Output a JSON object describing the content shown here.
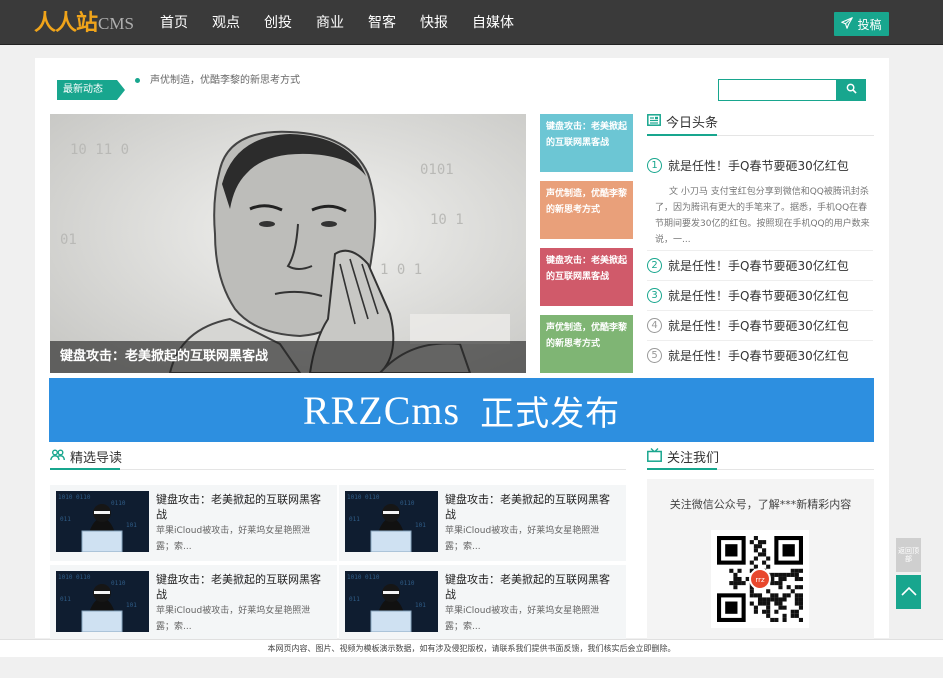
{
  "header": {
    "logo_cn": "人人站",
    "logo_en": "CMS",
    "nav": [
      "首页",
      "观点",
      "创投",
      "商业",
      "智客",
      "快报",
      "自媒体"
    ],
    "post_label": "投稿"
  },
  "news": {
    "tag": "最新动态",
    "ticker": "声优制造，优酷李黎的新思考方式"
  },
  "search": {
    "placeholder": ""
  },
  "hero": {
    "caption": "键盘攻击：老美掀起的互联网黑客战"
  },
  "tiles": [
    {
      "title": "键盘攻击：老美掀起的互联网黑客战",
      "color": "#6cc6d4"
    },
    {
      "title": "声优制造，优酷李黎的新思考方式",
      "color": "#e9a07a"
    },
    {
      "title": "键盘攻击：老美掀起的互联网黑客战",
      "color": "#d05a6a"
    },
    {
      "title": "声优制造，优酷李黎的新思考方式",
      "color": "#7fb574"
    }
  ],
  "headlines": {
    "title": "今日头条",
    "summary": "文 小刀马 支付宝红包分享到微信和QQ被腾讯封杀了，因为腾讯有更大的手笔来了。据悉，手机QQ在春节期间要发30亿的红包。按照现在手机QQ的用户数来说，一...",
    "items": [
      {
        "num": "1",
        "text": "就是任性！手Q春节要砸30亿红包"
      },
      {
        "num": "2",
        "text": "就是任性！手Q春节要砸30亿红包"
      },
      {
        "num": "3",
        "text": "就是任性！手Q春节要砸30亿红包"
      },
      {
        "num": "4",
        "text": "就是任性！手Q春节要砸30亿红包"
      },
      {
        "num": "5",
        "text": "就是任性！手Q春节要砸30亿红包"
      }
    ]
  },
  "banner": {
    "en": "RRZCms",
    "cn": "正式发布"
  },
  "featured": {
    "title": "精选导读",
    "cards": [
      {
        "title": "键盘攻击：老美掀起的互联网黑客战",
        "desc": "苹果iCloud被攻击，好莱坞女星艳照泄露；索..."
      },
      {
        "title": "键盘攻击：老美掀起的互联网黑客战",
        "desc": "苹果iCloud被攻击，好莱坞女星艳照泄露；索..."
      },
      {
        "title": "键盘攻击：老美掀起的互联网黑客战",
        "desc": "苹果iCloud被攻击，好莱坞女星艳照泄露；索..."
      },
      {
        "title": "键盘攻击：老美掀起的互联网黑客战",
        "desc": "苹果iCloud被攻击，好莱坞女星艳照泄露；索..."
      }
    ]
  },
  "follow": {
    "title": "关注我们",
    "text": "关注微信公众号，了解***新精彩内容",
    "qr_badge": "rrz"
  },
  "footer": {
    "text": "本网页内容、图片、视频为模板演示数据，如有涉及侵犯版权，请联系我们提供书面反馈，我们核实后会立即删除。"
  },
  "side": {
    "gray_label": "返回顶部"
  },
  "colors": {
    "accent": "#18a68e",
    "topbar": "#3a3a3a",
    "logo": "#f0a41a",
    "banner": "#2d8fe0"
  }
}
